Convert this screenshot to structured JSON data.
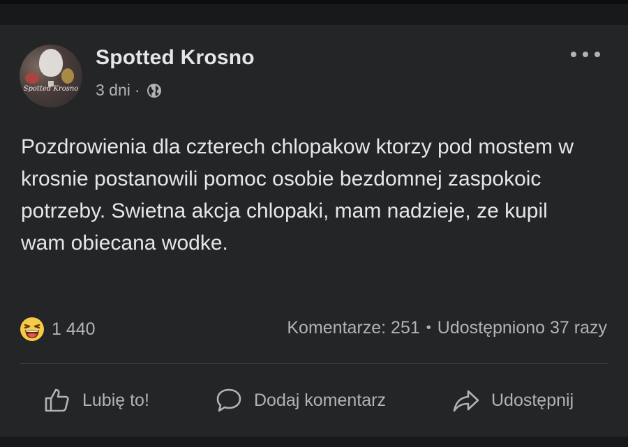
{
  "post": {
    "author": "Spotted Krosno",
    "avatar_text": "Spotted Krosno",
    "time": "3 dni",
    "separator": "·",
    "privacy_icon": "globe-icon",
    "more_icon": "more-options-icon",
    "text": "Pozdrowienia dla czterech chlopakow ktorzy pod mostem w krosnie postanowili pomoc osobie bezdomnej zaspokoic potrzeby. Swietna akcja chlopaki, mam nadzieje, ze kupil wam obiecana wodke."
  },
  "engagement": {
    "reaction_icon": "laughing-emoji-icon",
    "reaction_count": "1 440",
    "comments": "Komentarze: 251",
    "dot": "•",
    "shares": "Udostępniono 37 razy"
  },
  "actions": {
    "like": {
      "label": "Lubię to!",
      "icon": "thumbs-up-icon"
    },
    "comment": {
      "label": "Dodaj komentarz",
      "icon": "comment-bubble-icon"
    },
    "share": {
      "label": "Udostępnij",
      "icon": "share-arrow-icon"
    }
  },
  "colors": {
    "background": "#18191a",
    "card": "#242526",
    "primary_text": "#e4e6eb",
    "secondary_text": "#b0b3b8",
    "divider": "#3e4042"
  }
}
